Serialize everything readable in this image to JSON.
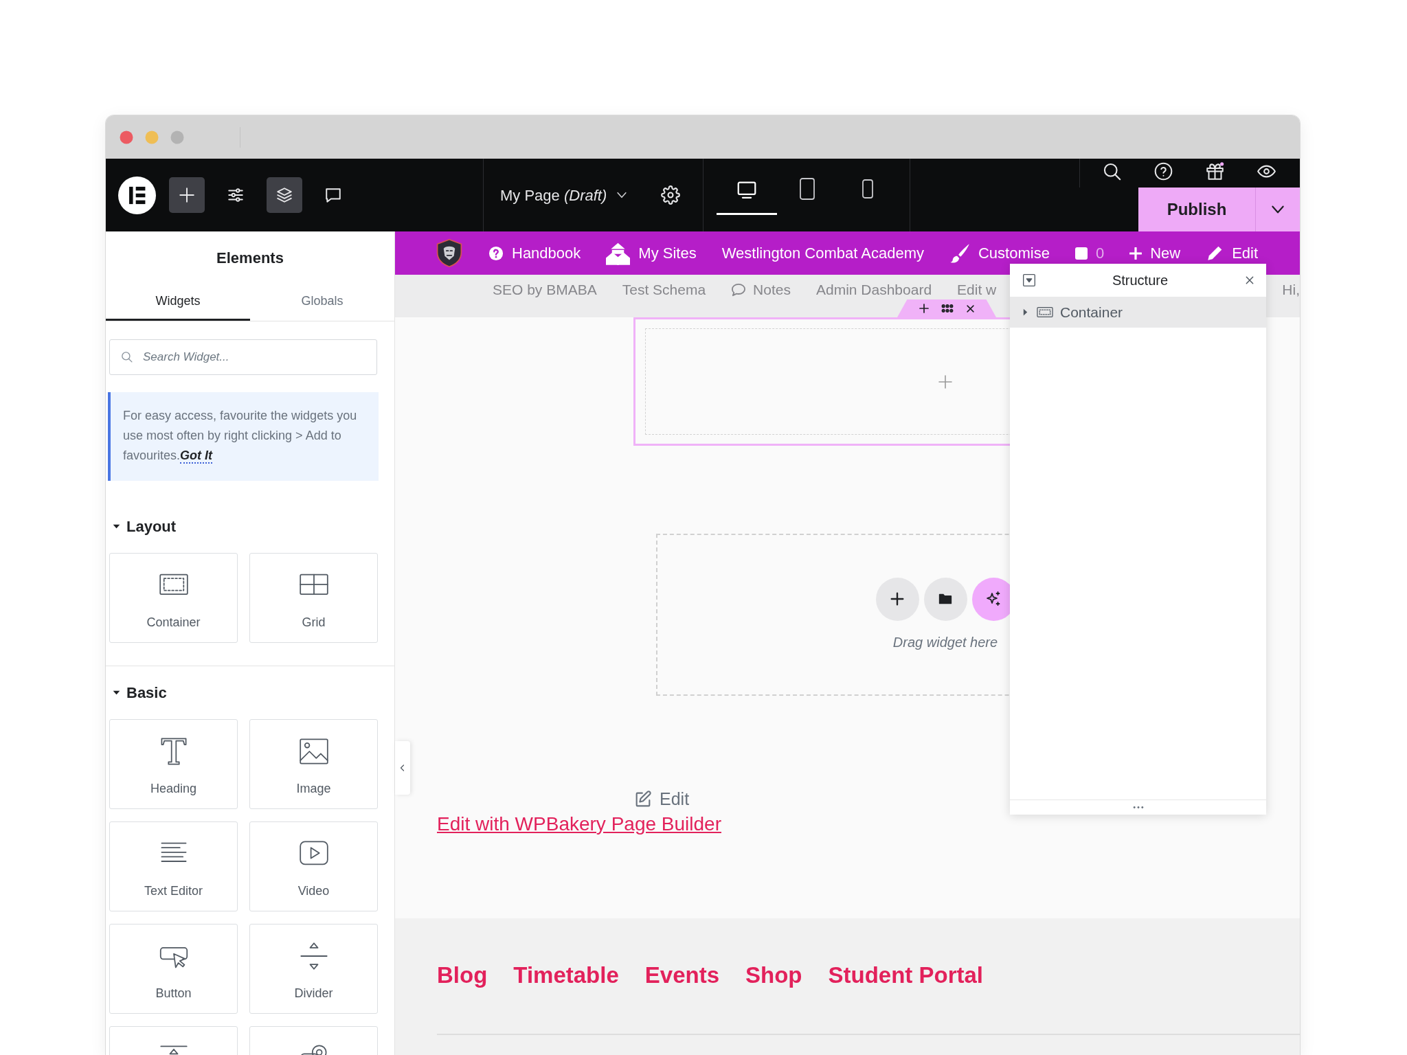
{
  "window": {
    "buttons": [
      {
        "kind": "close",
        "disabled": false
      },
      {
        "kind": "minimize",
        "disabled": false
      },
      {
        "kind": "zoom",
        "disabled": true
      }
    ]
  },
  "toolbar": {
    "tools": [
      {
        "kind": "add",
        "selected": true
      },
      {
        "kind": "settings",
        "selected": false
      },
      {
        "kind": "structure",
        "selected": true
      },
      {
        "kind": "notes",
        "selected": false
      }
    ],
    "page_title": "My Page *(Draft)*",
    "devices": [
      {
        "kind": "desktop",
        "selected": true
      },
      {
        "kind": "tablet",
        "selected": false
      },
      {
        "kind": "mobile",
        "selected": false
      }
    ],
    "utilities": [
      {
        "kind": "search",
        "dot": false
      },
      {
        "kind": "help",
        "dot": false
      },
      {
        "kind": "gift",
        "dot": true
      },
      {
        "kind": "preview",
        "dot": false
      }
    ],
    "publish": "Publish"
  },
  "panel": {
    "title": "Elements",
    "tabs": [
      {
        "label": "Widgets",
        "selected": true
      },
      {
        "label": "Globals",
        "selected": false
      }
    ],
    "search": {
      "placeholder": "Search Widget..."
    },
    "tip": {
      "text": "For easy access, favourite the widgets you use most often by right clicking > Add to favourites.",
      "link": "Got It"
    },
    "categories": [
      {
        "title": "Layout",
        "expanded": true,
        "widgets": [
          {
            "kind": "container",
            "label": "Container"
          },
          {
            "kind": "grid",
            "label": "Grid"
          }
        ]
      },
      {
        "title": "Basic",
        "expanded": true,
        "widgets": [
          {
            "kind": "heading",
            "label": "Heading"
          },
          {
            "kind": "image",
            "label": "Image"
          },
          {
            "kind": "text-editor",
            "label": "Text Editor"
          },
          {
            "kind": "video",
            "label": "Video"
          },
          {
            "kind": "button",
            "label": "Button"
          },
          {
            "kind": "divider",
            "label": "Divider"
          },
          {
            "kind": "spacer"
          },
          {
            "kind": "map"
          }
        ]
      }
    ]
  },
  "admin_bar": {
    "items": [
      {
        "kind": "logo"
      },
      {
        "kind": "help",
        "label": "Handbook"
      },
      {
        "kind": "sites",
        "label": "My Sites"
      },
      {
        "kind": "text",
        "label": "Westlington Combat Academy"
      },
      {
        "kind": "brush",
        "label": "Customise"
      },
      {
        "kind": "comments",
        "label": "0"
      },
      {
        "kind": "add",
        "label": "New"
      },
      {
        "kind": "pencil",
        "label": "Edit"
      }
    ]
  },
  "sub_bar": {
    "items": [
      {
        "kind": "text",
        "label": "SEO by BMABA"
      },
      {
        "kind": "text",
        "label": "Test Schema"
      },
      {
        "kind": "notes",
        "label": "Notes"
      },
      {
        "kind": "text",
        "label": "Admin Dashboard"
      },
      {
        "kind": "text",
        "label": "Edit w"
      },
      {
        "kind": "text",
        "label": "Hi,"
      }
    ]
  },
  "canvas": {
    "selected_container": {
      "selected": true,
      "actions": [
        {
          "kind": "add"
        },
        {
          "kind": "move"
        },
        {
          "kind": "delete"
        }
      ]
    },
    "drop_zone": {
      "actions": [
        {
          "kind": "add"
        },
        {
          "kind": "template"
        },
        {
          "kind": "ai"
        }
      ],
      "hint": "Drag widget here"
    },
    "edit_link": "Edit",
    "builder_link": "Edit with WPBakery Page Builder",
    "footer_links": [
      "Blog",
      "Timetable",
      "Events",
      "Shop",
      "Student Portal"
    ]
  },
  "structure": {
    "title": "Structure",
    "items": [
      {
        "label": "Container",
        "expanded": false,
        "selected": true
      }
    ]
  }
}
